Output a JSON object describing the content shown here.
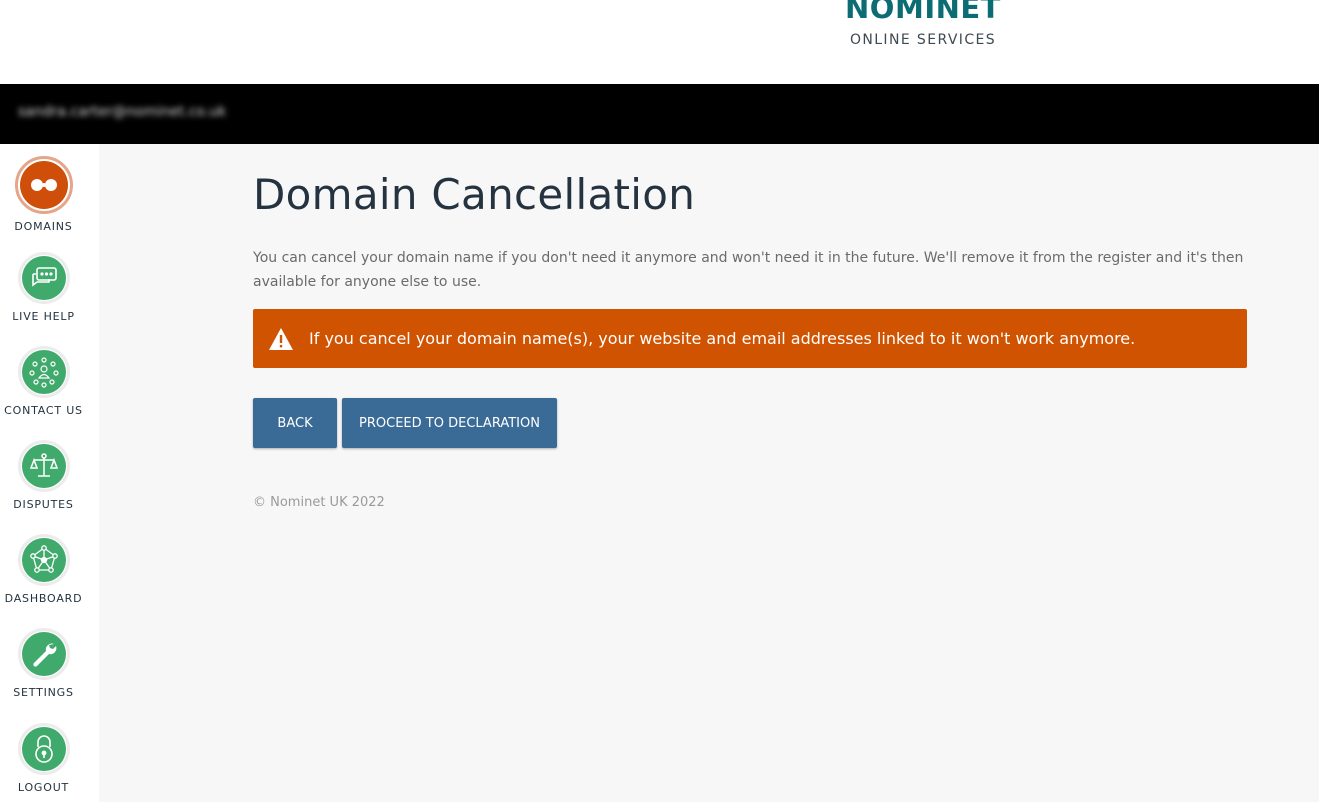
{
  "header": {
    "logo_main": "NOMINET",
    "logo_sub": "ONLINE SERVICES"
  },
  "topbar": {
    "user_email": "sandra.carter@nominet.co.uk"
  },
  "sidebar": {
    "items": [
      {
        "label": "DOMAINS",
        "icon": "domains-icon",
        "active": true
      },
      {
        "label": "LIVE HELP",
        "icon": "chat-icon",
        "active": false
      },
      {
        "label": "CONTACT US",
        "icon": "contact-icon",
        "active": false
      },
      {
        "label": "DISPUTES",
        "icon": "scales-icon",
        "active": false
      },
      {
        "label": "DASHBOARD",
        "icon": "network-icon",
        "active": false
      },
      {
        "label": "SETTINGS",
        "icon": "wrench-icon",
        "active": false
      },
      {
        "label": "LOGOUT",
        "icon": "lock-icon",
        "active": false
      }
    ]
  },
  "main": {
    "title": "Domain Cancellation",
    "intro": "You can cancel your domain name if you don't need it anymore and won't need it in the future. We'll remove it from the register and it's then available for anyone else to use.",
    "alert": "If you cancel your domain name(s), your website and email addresses linked to it won't work anymore.",
    "buttons": {
      "back": "BACK",
      "proceed": "PROCEED TO DECLARATION"
    },
    "footer": "© Nominet UK 2022"
  },
  "colors": {
    "brand_teal": "#0b6c73",
    "active_orange": "#cf4e0a",
    "nav_green": "#3faa6b",
    "alert_orange": "#cf5300",
    "button_blue": "#3a6a96"
  }
}
